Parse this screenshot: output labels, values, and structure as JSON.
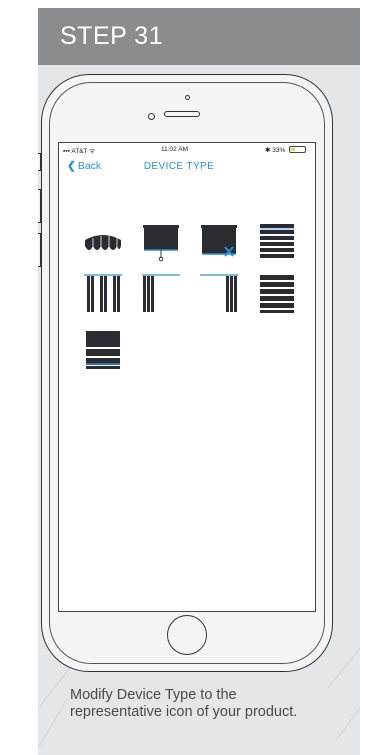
{
  "step": {
    "title": "STEP 31"
  },
  "status_bar": {
    "carrier": "AT&T",
    "time": "11:02 AM",
    "battery": "33%",
    "battery_level": 0.33
  },
  "nav": {
    "back_label": "Back",
    "title": "DEVICE TYPE"
  },
  "device_types": [
    {
      "icon": "awning-icon"
    },
    {
      "icon": "roller-shade-chain-icon"
    },
    {
      "icon": "roller-shade-motor-icon"
    },
    {
      "icon": "horizontal-blind-icon"
    },
    {
      "icon": "vertical-blind-center-icon"
    },
    {
      "icon": "vertical-blind-left-icon"
    },
    {
      "icon": "vertical-blind-right-icon"
    },
    {
      "icon": "cellular-shade-icon"
    },
    {
      "icon": "roman-shade-icon"
    }
  ],
  "caption": "Modify Device Type to the representative icon of your product.",
  "colors": {
    "header": "#8b8c8e",
    "card": "#e5e6e8",
    "accent": "#2c8fd8",
    "icon_dark": "#2b2c32"
  }
}
